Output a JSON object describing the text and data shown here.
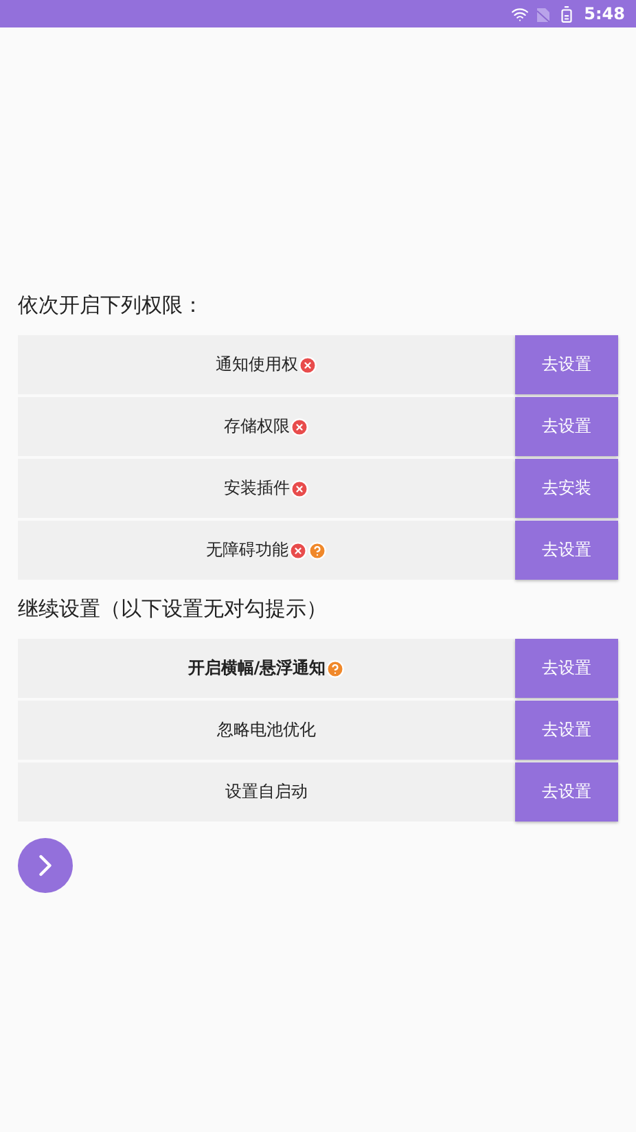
{
  "status_bar": {
    "time": "5:48"
  },
  "sections": [
    {
      "title": "依次开启下列权限：",
      "rows": [
        {
          "label": "通知使用权",
          "bold": false,
          "badges": [
            {
              "kind": "error"
            }
          ],
          "button": "去设置"
        },
        {
          "label": "存储权限",
          "bold": false,
          "badges": [
            {
              "kind": "error"
            }
          ],
          "button": "去设置"
        },
        {
          "label": "安装插件",
          "bold": false,
          "badges": [
            {
              "kind": "error"
            }
          ],
          "button": "去安装"
        },
        {
          "label": "无障碍功能",
          "bold": false,
          "badges": [
            {
              "kind": "error"
            },
            {
              "kind": "help"
            }
          ],
          "button": "去设置"
        }
      ]
    },
    {
      "title": "继续设置（以下设置无对勾提示）",
      "rows": [
        {
          "label": "开启横幅/悬浮通知",
          "bold": true,
          "badges": [
            {
              "kind": "help"
            }
          ],
          "button": "去设置"
        },
        {
          "label": "忽略电池优化",
          "bold": false,
          "badges": [],
          "button": "去设置"
        },
        {
          "label": "设置自启动",
          "bold": false,
          "badges": [],
          "button": "去设置"
        }
      ]
    }
  ]
}
